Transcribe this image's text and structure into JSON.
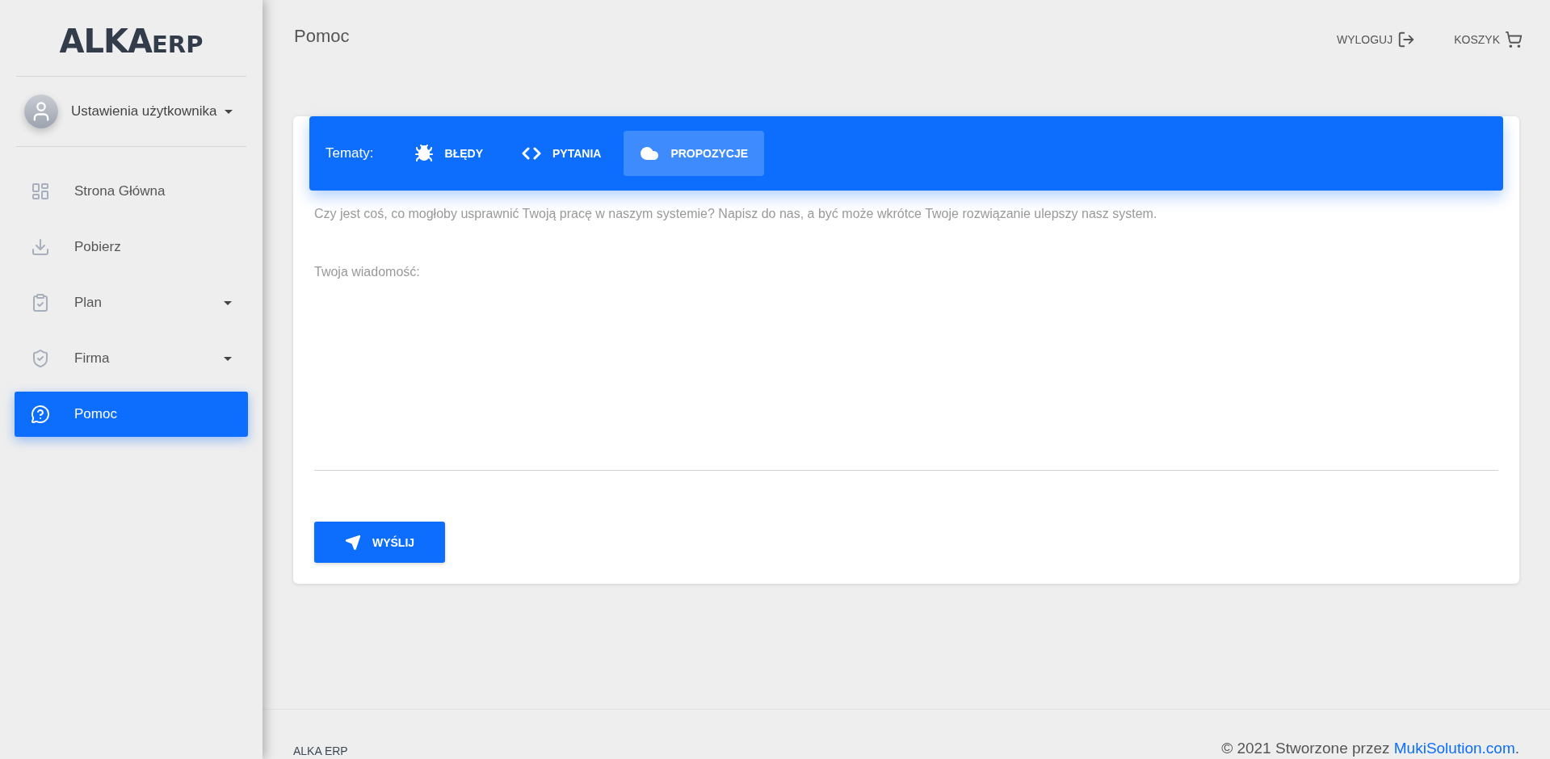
{
  "sidebar": {
    "logo": {
      "main": "ALKA",
      "suffix": "ERP"
    },
    "user": {
      "label": "Ustawienia użytkownika"
    },
    "items": [
      {
        "label": "Strona Główna",
        "expandable": false,
        "selected": false
      },
      {
        "label": "Pobierz",
        "expandable": false,
        "selected": false
      },
      {
        "label": "Plan",
        "expandable": true,
        "selected": false
      },
      {
        "label": "Firma",
        "expandable": true,
        "selected": false
      },
      {
        "label": "Pomoc",
        "expandable": false,
        "selected": true
      }
    ]
  },
  "header": {
    "title": "Pomoc",
    "actions": [
      {
        "label": "WYLOGUJ"
      },
      {
        "label": "KOSZYK"
      }
    ]
  },
  "topics": {
    "label": "Tematy:",
    "tabs": [
      {
        "label": "BŁĘDY",
        "selected": false
      },
      {
        "label": "PYTANIA",
        "selected": false
      },
      {
        "label": "PROPOZYCJE",
        "selected": true
      }
    ]
  },
  "form": {
    "description": "Czy jest coś, co mogłoby usprawnić Twoją pracę w naszym systemie? Napisz do nas, a być może wkrótce Twoje rozwiązanie ulepszy nasz system.",
    "message_label": "Twoja wiadomość:",
    "submit": "WYŚLIJ"
  },
  "footer": {
    "brand": "ALKA ERP",
    "copyright": "© 2021 Stworzone przez",
    "link": "MukiSolution.com",
    "end": "."
  }
}
